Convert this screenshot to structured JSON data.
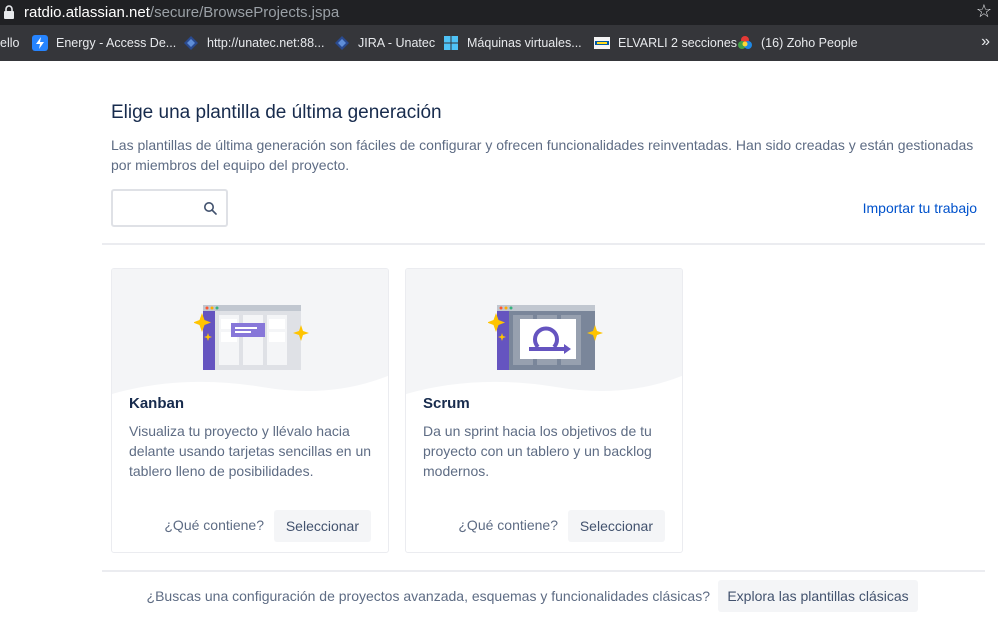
{
  "browser": {
    "url_host": "ratdio.atlassian.net",
    "url_path": "/secure/BrowseProjects.jspa",
    "bookmarks": [
      {
        "label": "ello"
      },
      {
        "label": "Energy - Access De..."
      },
      {
        "label": "http://unatec.net:88..."
      },
      {
        "label": "JIRA - Unatec"
      },
      {
        "label": "Máquinas virtuales..."
      },
      {
        "label": "ELVARLI 2 secciones"
      },
      {
        "label": "(16) Zoho People"
      }
    ],
    "more_label": "»"
  },
  "page": {
    "title": "Elige una plantilla de última generación",
    "description": "Las plantillas de última generación son fáciles de configurar y ofrecen funcionalidades reinventadas. Han sido creadas y están gestionadas por miembros del equipo del proyecto.",
    "search_placeholder": "",
    "import_link": "Importar tu trabajo"
  },
  "templates": [
    {
      "name": "Kanban",
      "description": "Visualiza tu proyecto y llévalo hacia delante usando tarjetas sencillas en un tablero lleno de posibilidades.",
      "whats_inside": "¿Qué contiene?",
      "select_label": "Seleccionar"
    },
    {
      "name": "Scrum",
      "description": "Da un sprint hacia los objetivos de tu proyecto con un tablero y un backlog modernos.",
      "whats_inside": "¿Qué contiene?",
      "select_label": "Seleccionar"
    }
  ],
  "footer": {
    "question": "¿Buscas una configuración de proyectos avanzada, esquemas y funcionalidades clásicas?",
    "button": "Explora las plantillas clásicas"
  },
  "colors": {
    "accent_link": "#0052cc",
    "illustration_purple": "#6554c0",
    "sparkle_yellow": "#ffc400"
  },
  "icons": {
    "lock": "lock-icon",
    "star": "star-icon",
    "search": "search-icon",
    "sparkle": "sparkle-icon"
  }
}
